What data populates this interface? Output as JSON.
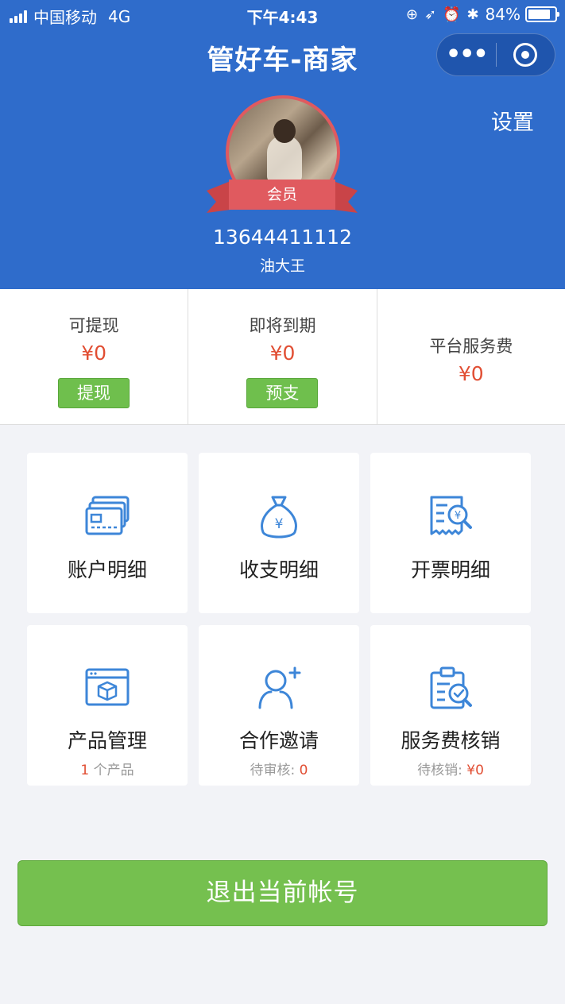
{
  "status_bar": {
    "carrier": "中国移动",
    "network": "4G",
    "time": "下午4:43",
    "battery": "84%",
    "battery_level": 0.84
  },
  "header": {
    "title": "管好车-商家",
    "settings_label": "设置",
    "badge_label": "会员",
    "phone": "13644411112",
    "nickname": "油大王",
    "colors": {
      "background": "#2f6ccb",
      "ribbon": "#e05a5f"
    }
  },
  "stats": [
    {
      "label": "可提现",
      "value": "¥0",
      "button": "提现"
    },
    {
      "label": "即将到期",
      "value": "¥0",
      "button": "预支"
    },
    {
      "label": "平台服务费",
      "value": "¥0"
    }
  ],
  "menu": [
    {
      "label": "账户明细",
      "icon": "card-icon"
    },
    {
      "label": "收支明细",
      "icon": "money-bag-icon"
    },
    {
      "label": "开票明细",
      "icon": "invoice-search-icon"
    },
    {
      "label": "产品管理",
      "icon": "product-box-icon",
      "sub_value": "1",
      "sub_text": " 个产品"
    },
    {
      "label": "合作邀请",
      "icon": "add-user-icon",
      "sub_text": "待审核: ",
      "sub_value": "0"
    },
    {
      "label": "服务费核销",
      "icon": "clipboard-check-icon",
      "sub_text": "待核销: ",
      "sub_value": "¥0"
    }
  ],
  "logout_label": "退出当前帐号",
  "colors": {
    "accent_red": "#e14e33",
    "green": "#75c04f",
    "icon_blue": "#3d86d8"
  }
}
